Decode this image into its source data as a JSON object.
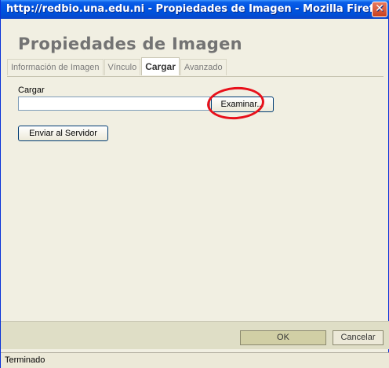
{
  "window": {
    "title": "http://redbio.una.edu.ni - Propiedades de Imagen - Mozilla Firefox",
    "close_glyph": "✕"
  },
  "dialog": {
    "title": "Propiedades de Imagen"
  },
  "tabs": [
    {
      "label": "Información de Imagen",
      "active": false
    },
    {
      "label": "Vínculo",
      "active": false
    },
    {
      "label": "Cargar",
      "active": true
    },
    {
      "label": "Avanzado",
      "active": false
    }
  ],
  "upload": {
    "label": "Cargar",
    "file_value": "",
    "browse_label": "Examinar...",
    "send_label": "Enviar al Servidor"
  },
  "annotation": {
    "color": "#e8101a"
  },
  "footer": {
    "ok_label": "OK",
    "cancel_label": "Cancelar"
  },
  "status": {
    "text": "Terminado"
  }
}
